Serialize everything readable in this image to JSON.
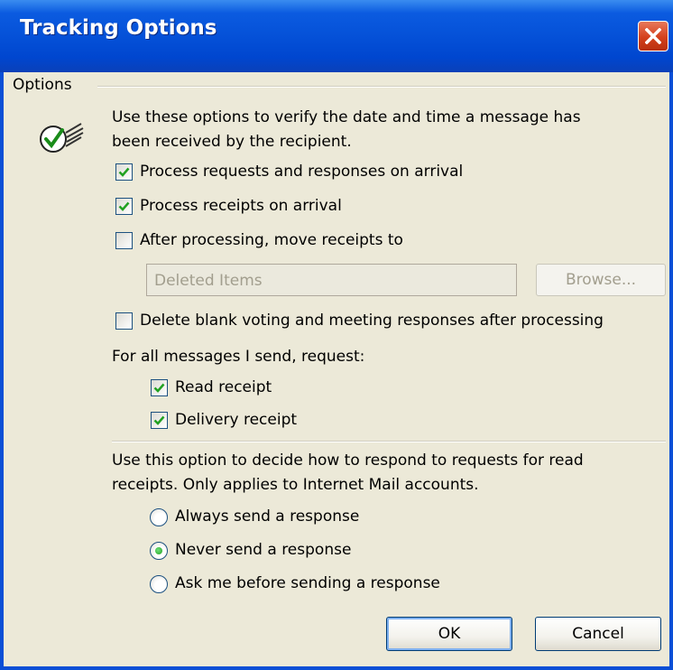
{
  "window": {
    "title": "Tracking Options"
  },
  "colors": {
    "title_bar": "#0551d8",
    "client_bg": "#ece9d8",
    "close_button": "#d4401c",
    "check_green": "#21a121"
  },
  "options": {
    "group_label": "Options",
    "intro_line1": "Use these options to verify the date and time a message has",
    "intro_line2": "been received by the recipient.",
    "process_requests": {
      "label": "Process requests and responses on arrival",
      "checked": true
    },
    "process_receipts": {
      "label": "Process receipts on arrival",
      "checked": true
    },
    "move_receipts": {
      "label": "After processing, move receipts to",
      "checked": false
    },
    "folder_field": {
      "value": "Deleted Items",
      "disabled": true
    },
    "browse_label": "Browse...",
    "delete_blank": {
      "label": "Delete blank voting and meeting responses after processing",
      "checked": false
    },
    "request_heading": "For all messages I send, request:",
    "read_receipt": {
      "label": "Read receipt",
      "checked": true
    },
    "delivery_receipt": {
      "label": "Delivery receipt",
      "checked": true
    },
    "respond_line1": "Use this option to decide how to respond to requests for read",
    "respond_line2": "receipts. Only applies to Internet Mail accounts.",
    "radio_options": [
      {
        "label": "Always send a response",
        "selected": false
      },
      {
        "label": "Never send a response",
        "selected": true
      },
      {
        "label": "Ask me before sending a response",
        "selected": false
      }
    ]
  },
  "buttons": {
    "ok": "OK",
    "cancel": "Cancel"
  },
  "icons": {
    "close": "close-icon",
    "tracking": "tracking-check-icon"
  }
}
